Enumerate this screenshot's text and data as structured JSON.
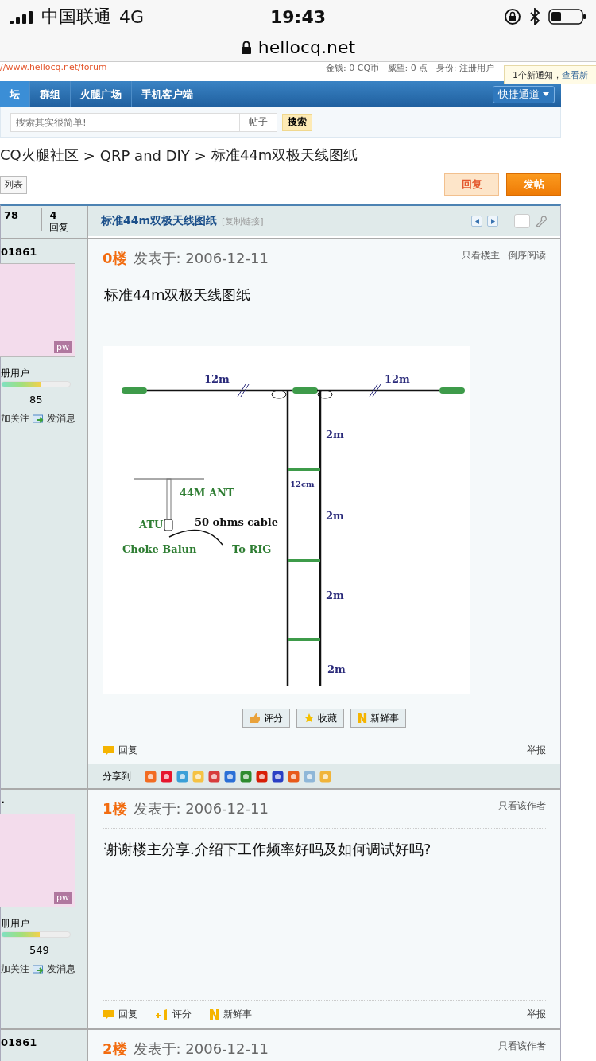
{
  "status_bar": {
    "carrier": "中国联通",
    "network": "4G",
    "time": "19:43"
  },
  "url_bar": {
    "domain": "hellocq.net"
  },
  "top_strip": {
    "site_link": "//www.hellocq.net/forum",
    "user_info": "金钱: 0 CQ币   威望: 0 点   身份: 注册用户"
  },
  "notification": {
    "text": "1个新通知，",
    "link": "查看新"
  },
  "nav": {
    "items": [
      {
        "label": "坛",
        "selected": true
      },
      {
        "label": "群组",
        "selected": false
      },
      {
        "label": "火腿广场",
        "selected": false
      },
      {
        "label": "手机客户端",
        "selected": false
      }
    ],
    "quick_menu": "快捷通道"
  },
  "search": {
    "placeholder": "搜索其实很简单!",
    "scope": "帖子",
    "button": "搜索"
  },
  "breadcrumb": [
    "CQ火腿社区",
    "QRP and DIY",
    "标准44m双极天线图纸"
  ],
  "breadcrumb_separator": ">",
  "back_to_list": "列表",
  "actions": {
    "reply": "回复",
    "new_post": "发帖"
  },
  "thread": {
    "checked": false,
    "views": "78",
    "replies": "4",
    "replies_label": "回复",
    "title": "标准44m双极天线图纸",
    "copy_link": "[复制链接]"
  },
  "posts": [
    {
      "user": "01861",
      "avatar_mark": "pw",
      "group": "册用户",
      "level": 0.57,
      "posts_count": "85",
      "follow": "加关注",
      "message": "发消息",
      "floor": "0楼",
      "date": "发表于: 2006-12-11",
      "links": [
        "只看楼主",
        "倒序阅读"
      ],
      "body": "标准44m双极天线图纸",
      "diagram": {
        "labels": [
          {
            "text": "12m",
            "kind": "dim"
          },
          {
            "text": "12m",
            "kind": "dim"
          },
          {
            "text": "2m",
            "kind": "dim"
          },
          {
            "text": "12cm",
            "kind": "dim"
          },
          {
            "text": "2m",
            "kind": "dim"
          },
          {
            "text": "2m",
            "kind": "dim"
          },
          {
            "text": "2m",
            "kind": "dim"
          },
          {
            "text": "44M ANT",
            "kind": "note"
          },
          {
            "text": "ATU",
            "kind": "note"
          },
          {
            "text": "50 ohms cable",
            "kind": "plain"
          },
          {
            "text": "Choke Balun",
            "kind": "note"
          },
          {
            "text": "To RIG",
            "kind": "note"
          }
        ]
      },
      "buttons": [
        "评分",
        "收藏",
        "新鲜事"
      ],
      "footer": [
        {
          "label": "回复",
          "kind": "reply"
        }
      ],
      "report": "举报",
      "share": {
        "label": "分享到"
      }
    },
    {
      "user": "·",
      "avatar_mark": "pw",
      "group": "册用户",
      "level": 0.56,
      "posts_count": "549",
      "follow": "加关注",
      "message": "发消息",
      "floor": "1楼",
      "date": "发表于: 2006-12-11",
      "links": [
        "只看该作者"
      ],
      "body": "谢谢楼主分享.介绍下工作频率好吗及如何调试好吗?",
      "footer": [
        {
          "label": "回复",
          "kind": "reply"
        },
        {
          "label": "评分",
          "kind": "rate"
        },
        {
          "label": "新鲜事",
          "kind": "news"
        }
      ],
      "report": "举报"
    },
    {
      "user": "01861",
      "floor": "2楼",
      "date": "发表于: 2006-12-11",
      "links": [
        "只看该作者"
      ]
    }
  ]
}
